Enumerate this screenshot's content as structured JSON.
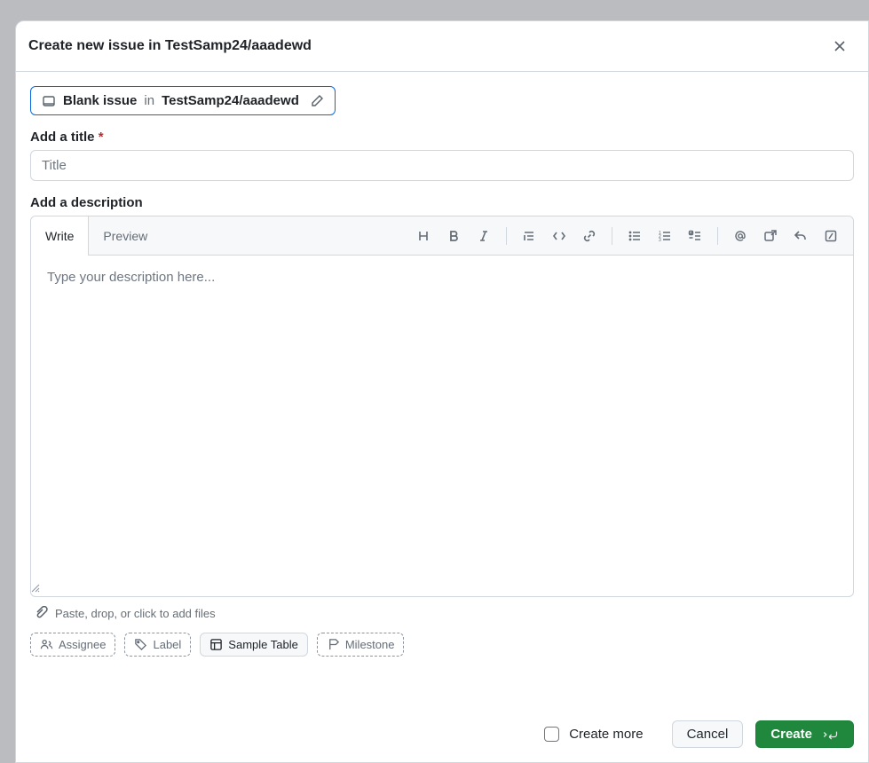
{
  "header": {
    "title": "Create new issue in TestSamp24/aaadewd"
  },
  "template": {
    "name": "Blank issue",
    "in_word": "in",
    "repo": "TestSamp24/aaadewd"
  },
  "title_field": {
    "label": "Add a title",
    "placeholder": "Title",
    "value": ""
  },
  "description": {
    "label": "Add a description",
    "tabs": {
      "write": "Write",
      "preview": "Preview"
    },
    "placeholder": "Type your description here...",
    "value": ""
  },
  "attach": {
    "hint": "Paste, drop, or click to add files"
  },
  "meta": {
    "assignee": "Assignee",
    "label": "Label",
    "sample_table": "Sample Table",
    "milestone": "Milestone"
  },
  "footer": {
    "create_more": "Create more",
    "cancel": "Cancel",
    "create": "Create"
  }
}
